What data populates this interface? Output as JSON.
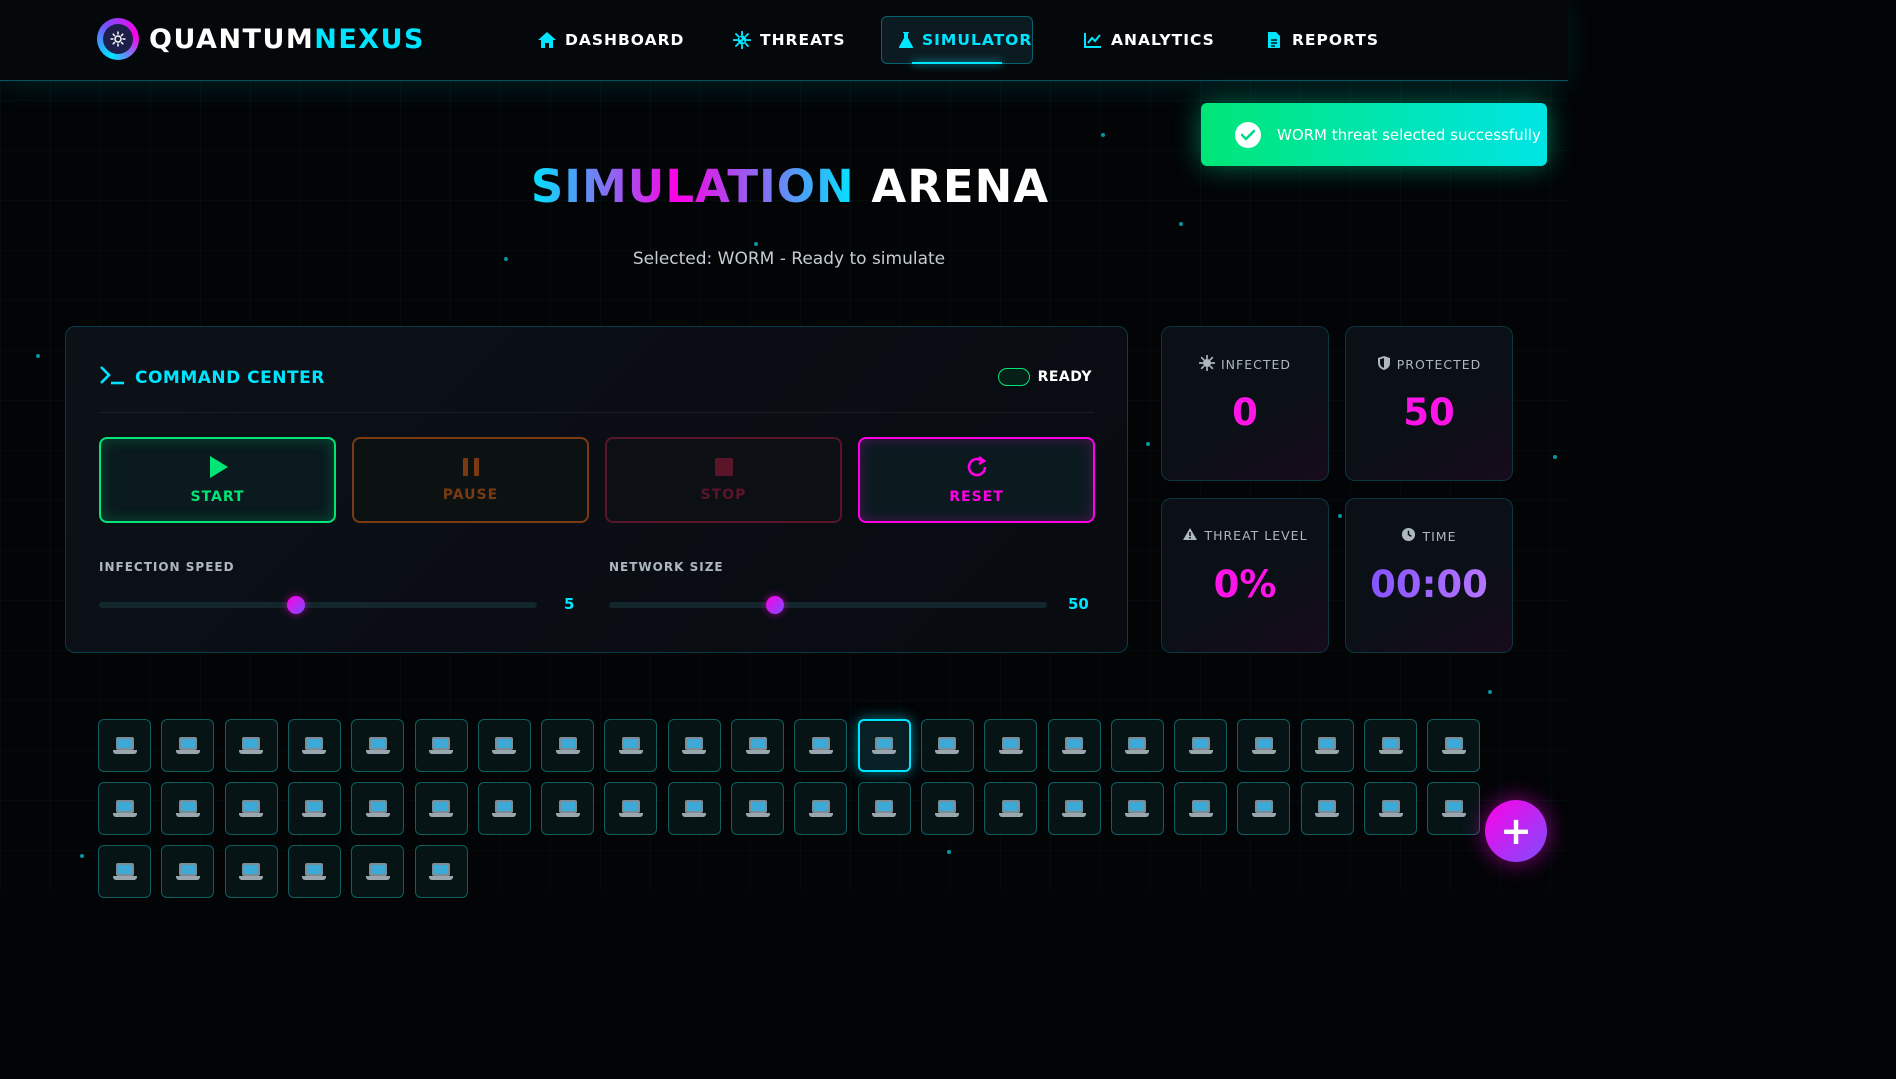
{
  "app": {
    "logo_part1": "QUANTUM",
    "logo_part2": "NEXUS"
  },
  "nav": {
    "items": [
      {
        "label": "DASHBOARD",
        "icon": "home-icon"
      },
      {
        "label": "THREATS",
        "icon": "virus-icon"
      },
      {
        "label": "SIMULATOR",
        "icon": "flask-icon",
        "active": true
      },
      {
        "label": "ANALYTICS",
        "icon": "chart-line-icon"
      },
      {
        "label": "REPORTS",
        "icon": "document-icon"
      }
    ]
  },
  "toast": {
    "message": "WORM threat selected successfully",
    "icon": "check-circle-icon"
  },
  "hero": {
    "title_grad": "SIMULATION",
    "title_plain": "ARENA",
    "subtitle": "Selected: WORM - Ready to simulate"
  },
  "command": {
    "title": "COMMAND CENTER",
    "status": "READY",
    "buttons": {
      "start": "START",
      "pause": "PAUSE",
      "stop": "STOP",
      "reset": "RESET"
    },
    "infection_speed": {
      "label": "INFECTION SPEED",
      "value": "5",
      "fraction": 0.45
    },
    "network_size": {
      "label": "NETWORK SIZE",
      "value": "50",
      "fraction": 0.38
    }
  },
  "stats": {
    "infected": {
      "label": "INFECTED",
      "value": "0"
    },
    "protected": {
      "label": "PROTECTED",
      "value": "50"
    },
    "threat_level": {
      "label": "THREAT LEVEL",
      "value": "0%"
    },
    "time": {
      "label": "TIME",
      "value": "00:00"
    }
  },
  "network": {
    "node_count": 50,
    "focused_index": 12
  },
  "colors": {
    "accent": "#00e5ff",
    "magenta": "#ff00e5",
    "success": "#00e676"
  }
}
